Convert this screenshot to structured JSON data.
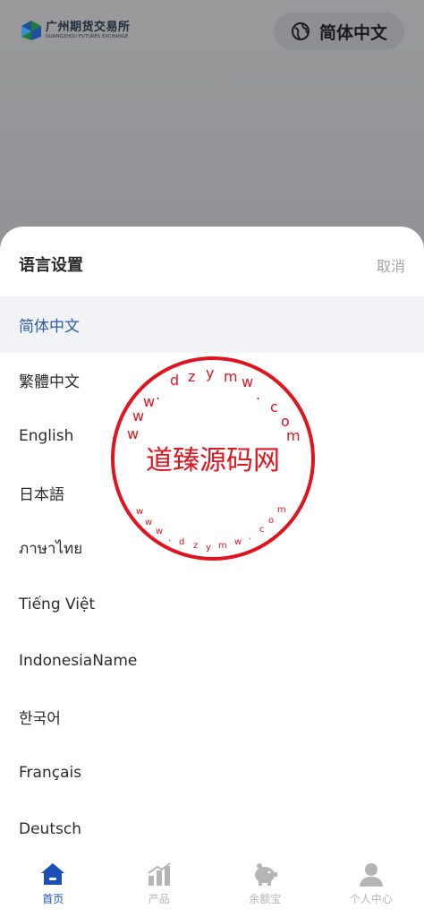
{
  "header": {
    "logo_cn": "广州期货交易所",
    "logo_en": "GUANGZHOU FUTURES EXCHANGE",
    "current_language": "简体中文"
  },
  "sheet": {
    "title": "语言设置",
    "cancel_label": "取消",
    "languages": [
      {
        "label": "简体中文",
        "selected": true
      },
      {
        "label": "繁體中文",
        "selected": false
      },
      {
        "label": "English",
        "selected": false
      },
      {
        "label": "日本語",
        "selected": false
      },
      {
        "label": "ภาษาไทย",
        "selected": false
      },
      {
        "label": "Tiếng Việt",
        "selected": false
      },
      {
        "label": "IndonesiaName",
        "selected": false
      },
      {
        "label": "한국어",
        "selected": false
      },
      {
        "label": "Français",
        "selected": false
      },
      {
        "label": "Deutsch",
        "selected": false
      }
    ]
  },
  "watermark": {
    "main_text": "道臻源码网",
    "ring_text": "www.dzymw.com"
  },
  "tabbar": {
    "items": [
      {
        "label": "首页",
        "icon": "home-icon",
        "active": true
      },
      {
        "label": "产品",
        "icon": "bar-chart-icon",
        "active": false
      },
      {
        "label": "余额宝",
        "icon": "piggy-bank-icon",
        "active": false
      },
      {
        "label": "个人中心",
        "icon": "user-icon",
        "active": false
      }
    ]
  },
  "colors": {
    "accent": "#1a4fb8",
    "selected_text": "#2e5aa8",
    "selected_bg": "#f1f3f6",
    "muted": "#b5b5b5",
    "stamp": "#e0141e"
  }
}
